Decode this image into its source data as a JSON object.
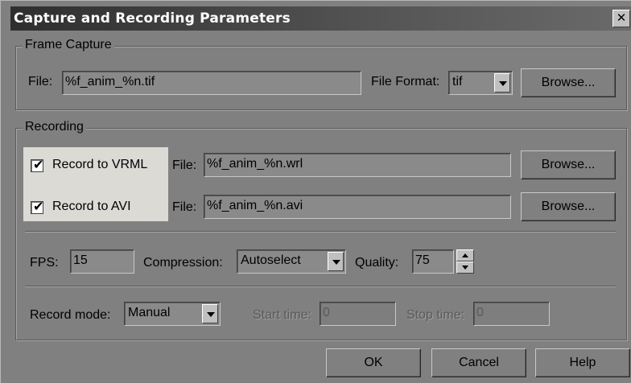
{
  "dialog": {
    "title": "Capture and Recording Parameters",
    "close_glyph": "✕"
  },
  "frame_capture": {
    "group_label": "Frame Capture",
    "file_label": "File:",
    "file_value": "%f_anim_%n.tif",
    "format_label": "File Format:",
    "format_value": "tif",
    "browse_label": "Browse..."
  },
  "recording": {
    "group_label": "Recording",
    "vrml": {
      "checkbox_label": "Record to VRML",
      "checked": true,
      "file_label": "File:",
      "file_value": "%f_anim_%n.wrl",
      "browse_label": "Browse..."
    },
    "avi": {
      "checkbox_label": "Record to AVI",
      "checked": true,
      "file_label": "File:",
      "file_value": "%f_anim_%n.avi",
      "browse_label": "Browse..."
    },
    "fps_label": "FPS:",
    "fps_value": "15",
    "compression_label": "Compression:",
    "compression_value": "Autoselect",
    "quality_label": "Quality:",
    "quality_value": "75",
    "record_mode_label": "Record mode:",
    "record_mode_value": "Manual",
    "start_time_label": "Start time:",
    "start_time_value": "0",
    "stop_time_label": "Stop time:",
    "stop_time_value": "0"
  },
  "footer": {
    "ok_label": "OK",
    "cancel_label": "Cancel",
    "help_label": "Help"
  },
  "icons": {
    "checkmark": "✔"
  }
}
